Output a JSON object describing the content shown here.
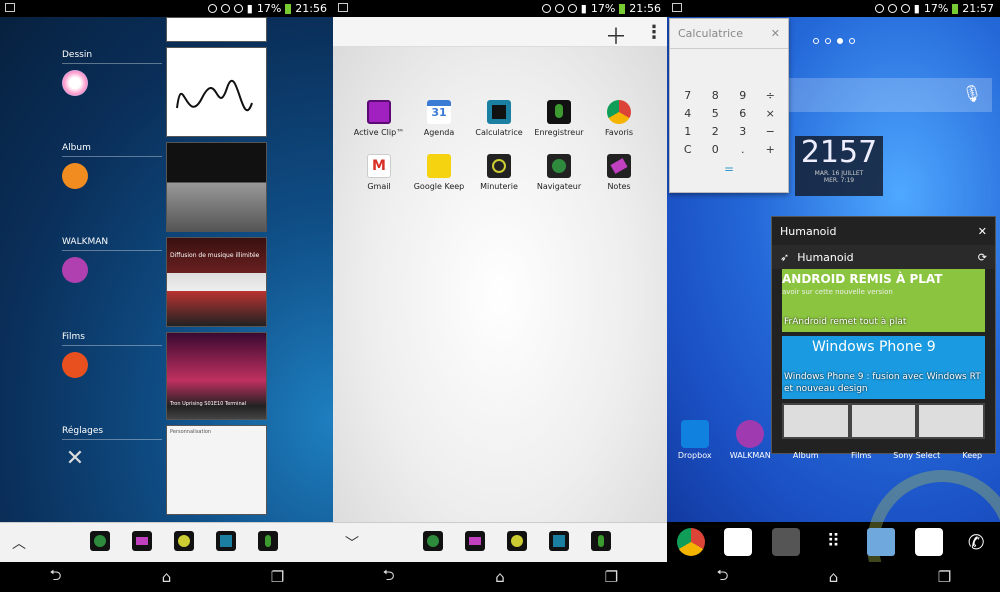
{
  "status": {
    "battery": "17%",
    "time_left": "21:56",
    "time_mid": "21:56",
    "time_right": "21:57"
  },
  "panel1": {
    "sections": [
      {
        "label": "Dessin",
        "color": "#e8e8e8"
      },
      {
        "label": "Album",
        "color": "#f08c20"
      },
      {
        "label": "WALKMAN",
        "color": "#b040b0"
      },
      {
        "label": "Films",
        "color": "#e85020"
      },
      {
        "label": "Réglages",
        "color": "#dddddd"
      }
    ],
    "thumbs": [
      {
        "caption": "Dessin"
      },
      {
        "caption": "Album"
      },
      {
        "caption": "Diffusion de musique illimitée"
      },
      {
        "caption": "Tron Uprising S01E10 Terminal"
      },
      {
        "caption": "Personnalisation"
      }
    ],
    "tray_toggle": "^"
  },
  "panel2": {
    "apps": [
      {
        "label": "Active Clip™",
        "color": "#a020c0"
      },
      {
        "label": "Agenda",
        "color": "#3a7bd5",
        "text": "31"
      },
      {
        "label": "Calculatrice",
        "color": "#1a7fa0"
      },
      {
        "label": "Enregistreur",
        "color": "#3c9a30"
      },
      {
        "label": "Favoris",
        "color": "#e04030"
      },
      {
        "label": "Gmail",
        "color": "#d93025"
      },
      {
        "label": "Google Keep",
        "color": "#f5d310"
      },
      {
        "label": "Minuterie",
        "color": "#222222"
      },
      {
        "label": "Navigateur",
        "color": "#2e8b3e"
      },
      {
        "label": "Notes",
        "color": "#c040c0"
      }
    ],
    "tray_toggle": "v"
  },
  "panel3": {
    "calculator": {
      "title": "Calculatrice",
      "keys": [
        "7",
        "8",
        "9",
        "÷",
        "4",
        "5",
        "6",
        "×",
        "1",
        "2",
        "3",
        "−",
        "C",
        "0",
        ".",
        "+"
      ],
      "equals": "="
    },
    "clock": {
      "time": "2157",
      "date": "MAR. 16 JUILLET",
      "alarm": "MER. 7:19"
    },
    "humanoid": {
      "title": "Humanoid",
      "feed_title": "Humanoid",
      "card1_big": "ANDROID REMIS À PLAT",
      "card1_sub": "avoir sur cette nouvelle version",
      "card1_caption": "FrAndroid remet tout à plat",
      "card2_big": "Windows Phone 9",
      "card2_caption": "Windows Phone 9 : fusion avec Windows RT et nouveau design"
    },
    "shortcuts": [
      {
        "label": "Dropbox",
        "color": "#1081de"
      },
      {
        "label": "WALKMAN",
        "color": "#a03ab0"
      },
      {
        "label": "Album",
        "color": "#1a5fc0"
      },
      {
        "label": "Films",
        "color": "#1a5fc0"
      },
      {
        "label": "Sony Select",
        "color": "#1a5fc0"
      },
      {
        "label": "Keep",
        "color": "#1a5fc0"
      }
    ],
    "dock": [
      {
        "color": "#e53935"
      },
      {
        "color": "#ffffff"
      },
      {
        "color": "#555555"
      },
      {
        "color": "#ffffff"
      },
      {
        "color": "#6fa8dc"
      },
      {
        "color": "#ffffff"
      },
      {
        "color": "#ffffff"
      }
    ]
  }
}
